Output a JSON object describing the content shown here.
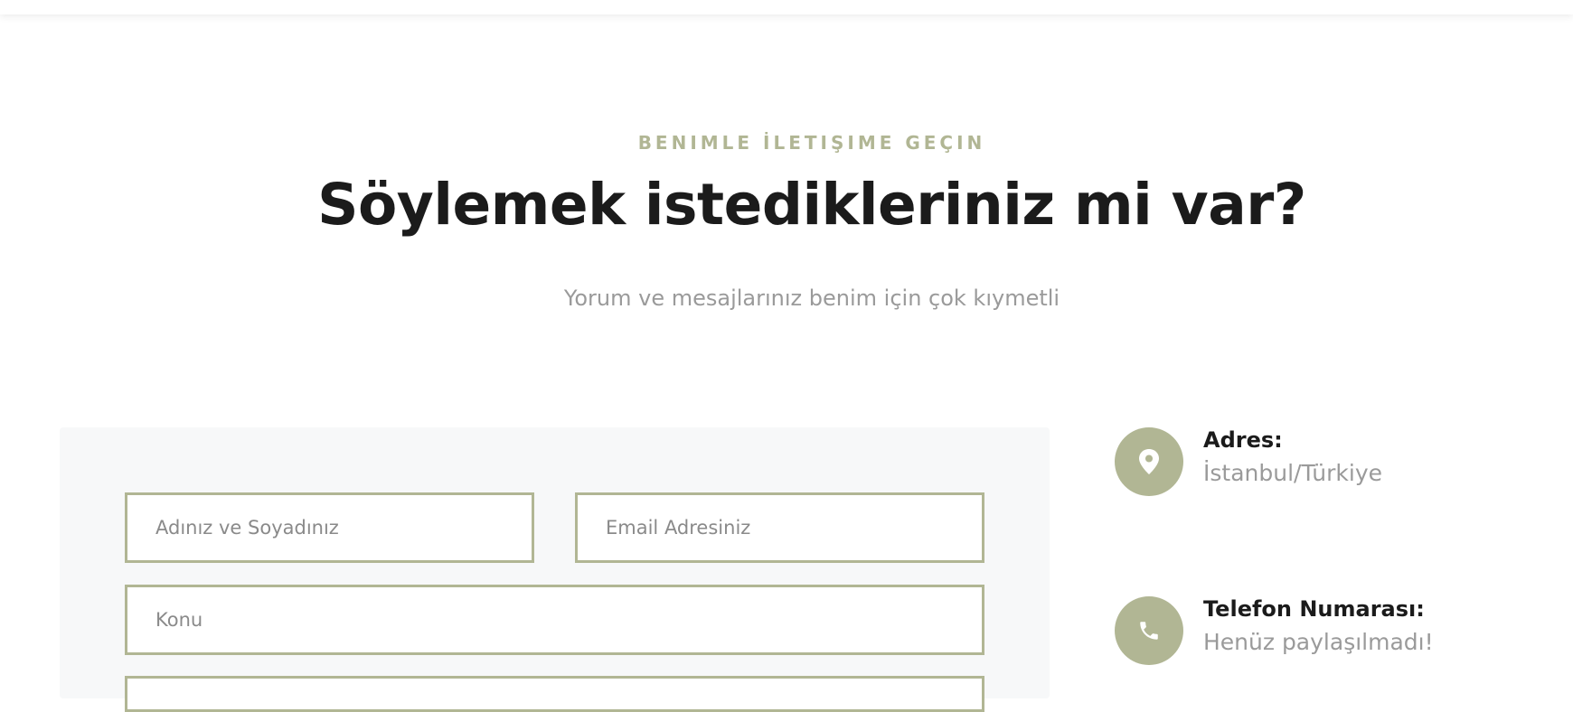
{
  "header": {
    "kicker": "BENIMLE İLETIŞIME GEÇIN",
    "title": "Söylemek istedikleriniz mi var?",
    "subtitle": "Yorum ve mesajlarınız benim için çok kıymetli"
  },
  "form": {
    "name_placeholder": "Adınız ve Soyadınız",
    "email_placeholder": "Email Adresiniz",
    "subject_placeholder": "Konu"
  },
  "contact_info": {
    "address": {
      "icon": "map-pin-icon",
      "label": "Adres:",
      "value": "İstanbul/Türkiye"
    },
    "phone": {
      "icon": "phone-icon",
      "label": "Telefon Numarası:",
      "value": "Henüz paylaşılmadı!"
    }
  },
  "colors": {
    "accent": "#b1b694",
    "heading": "#1b1b1b",
    "muted_text": "#9a9a9a",
    "form_panel_bg": "#f7f8f9"
  }
}
